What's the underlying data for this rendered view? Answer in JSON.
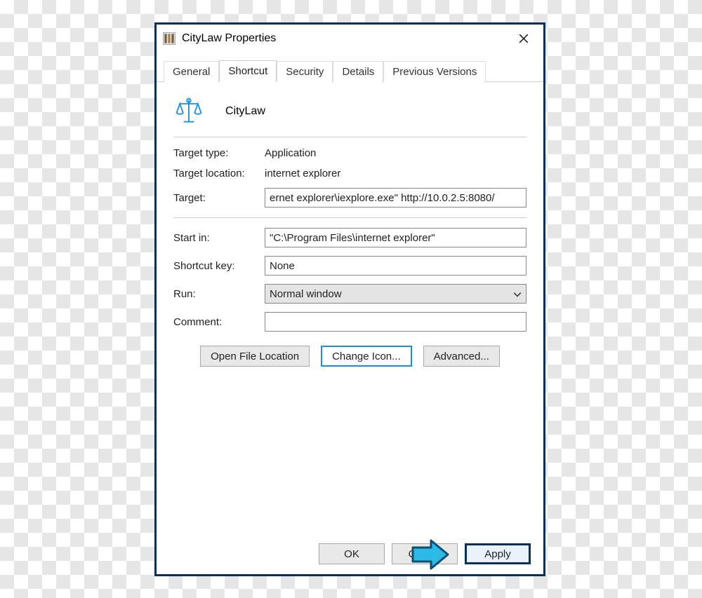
{
  "window": {
    "title": "CityLaw Properties"
  },
  "tabs": {
    "general": "General",
    "shortcut": "Shortcut",
    "security": "Security",
    "details": "Details",
    "previous": "Previous Versions"
  },
  "header": {
    "name": "CityLaw"
  },
  "fields": {
    "target_type_label": "Target type:",
    "target_type_value": "Application",
    "target_location_label": "Target location:",
    "target_location_value": "internet explorer",
    "target_label": "Target:",
    "target_value": "ernet explorer\\iexplore.exe\" http://10.0.2.5:8080/",
    "startin_label": "Start in:",
    "startin_value": "\"C:\\Program Files\\internet explorer\"",
    "shortcutkey_label": "Shortcut key:",
    "shortcutkey_value": "None",
    "run_label": "Run:",
    "run_value": "Normal window",
    "comment_label": "Comment:",
    "comment_value": ""
  },
  "buttons": {
    "open_file_location": "Open File Location",
    "change_icon": "Change Icon...",
    "advanced": "Advanced...",
    "ok": "OK",
    "cancel": "Cancel",
    "apply": "Apply"
  }
}
